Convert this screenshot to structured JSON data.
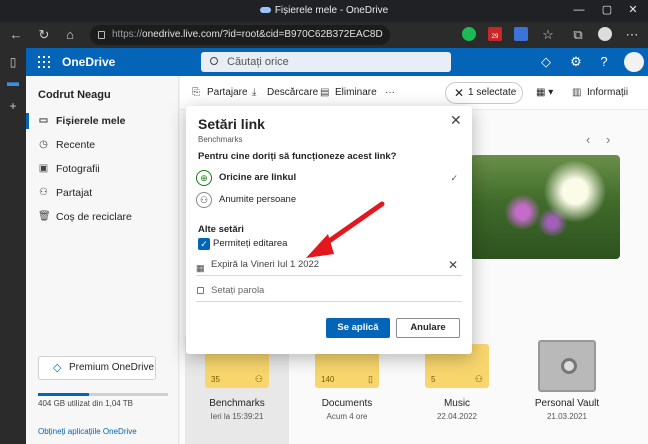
{
  "browser": {
    "window_title": "Fișierele mele - OneDrive",
    "url_scheme": "https://",
    "url_rest": "onedrive.live.com/?id=root&cid=B970C62B372EAC8D",
    "badge_count": "29"
  },
  "header": {
    "app_name": "OneDrive",
    "search_placeholder": "Căutați orice"
  },
  "sidebar": {
    "user_name": "Codrut Neagu",
    "items": [
      {
        "label": "Fișierele mele",
        "icon": "folder-icon",
        "selected": true
      },
      {
        "label": "Recente",
        "icon": "clock-icon"
      },
      {
        "label": "Fotografii",
        "icon": "image-icon"
      },
      {
        "label": "Partajat",
        "icon": "people-icon"
      },
      {
        "label": "Coș de reciclare",
        "icon": "trash-icon"
      }
    ],
    "premium_label": "Premium OneDrive",
    "storage_text": "404 GB utilizat din 1,04 TB",
    "storage_fraction": 0.39,
    "get_apps": "Obțineți aplicațiile OneDrive"
  },
  "commandbar": {
    "share": "Partajare",
    "download": "Descărcare",
    "delete": "Eliminare",
    "more": "···",
    "selected": "1 selectate",
    "info": "Informații"
  },
  "tiles": [
    {
      "name": "Benchmarks",
      "date": "Ieri la 15:39:21",
      "count": "35",
      "selected": true
    },
    {
      "name": "Documents",
      "date": "Acum 4 ore",
      "count": "140"
    },
    {
      "name": "Music",
      "date": "22.04.2022",
      "count": "5"
    },
    {
      "name": "Personal Vault",
      "date": "21.03.2021"
    }
  ],
  "dialog": {
    "title": "Setări link",
    "subtitle": "Benchmarks",
    "question": "Pentru cine doriți să funcționeze acest link?",
    "option_anyone": "Oricine are linkul",
    "option_specific": "Anumite persoane",
    "other_settings": "Alte setări",
    "allow_edit": "Permiteți editarea",
    "expires_prefix": "Expiră la",
    "expires_date": "Vineri Iul 1 2022",
    "password_placeholder": "Setați parola",
    "apply": "Se aplică",
    "cancel": "Anulare"
  },
  "colors": {
    "accent": "#0364b8",
    "annotation_arrow": "#e3171e"
  }
}
